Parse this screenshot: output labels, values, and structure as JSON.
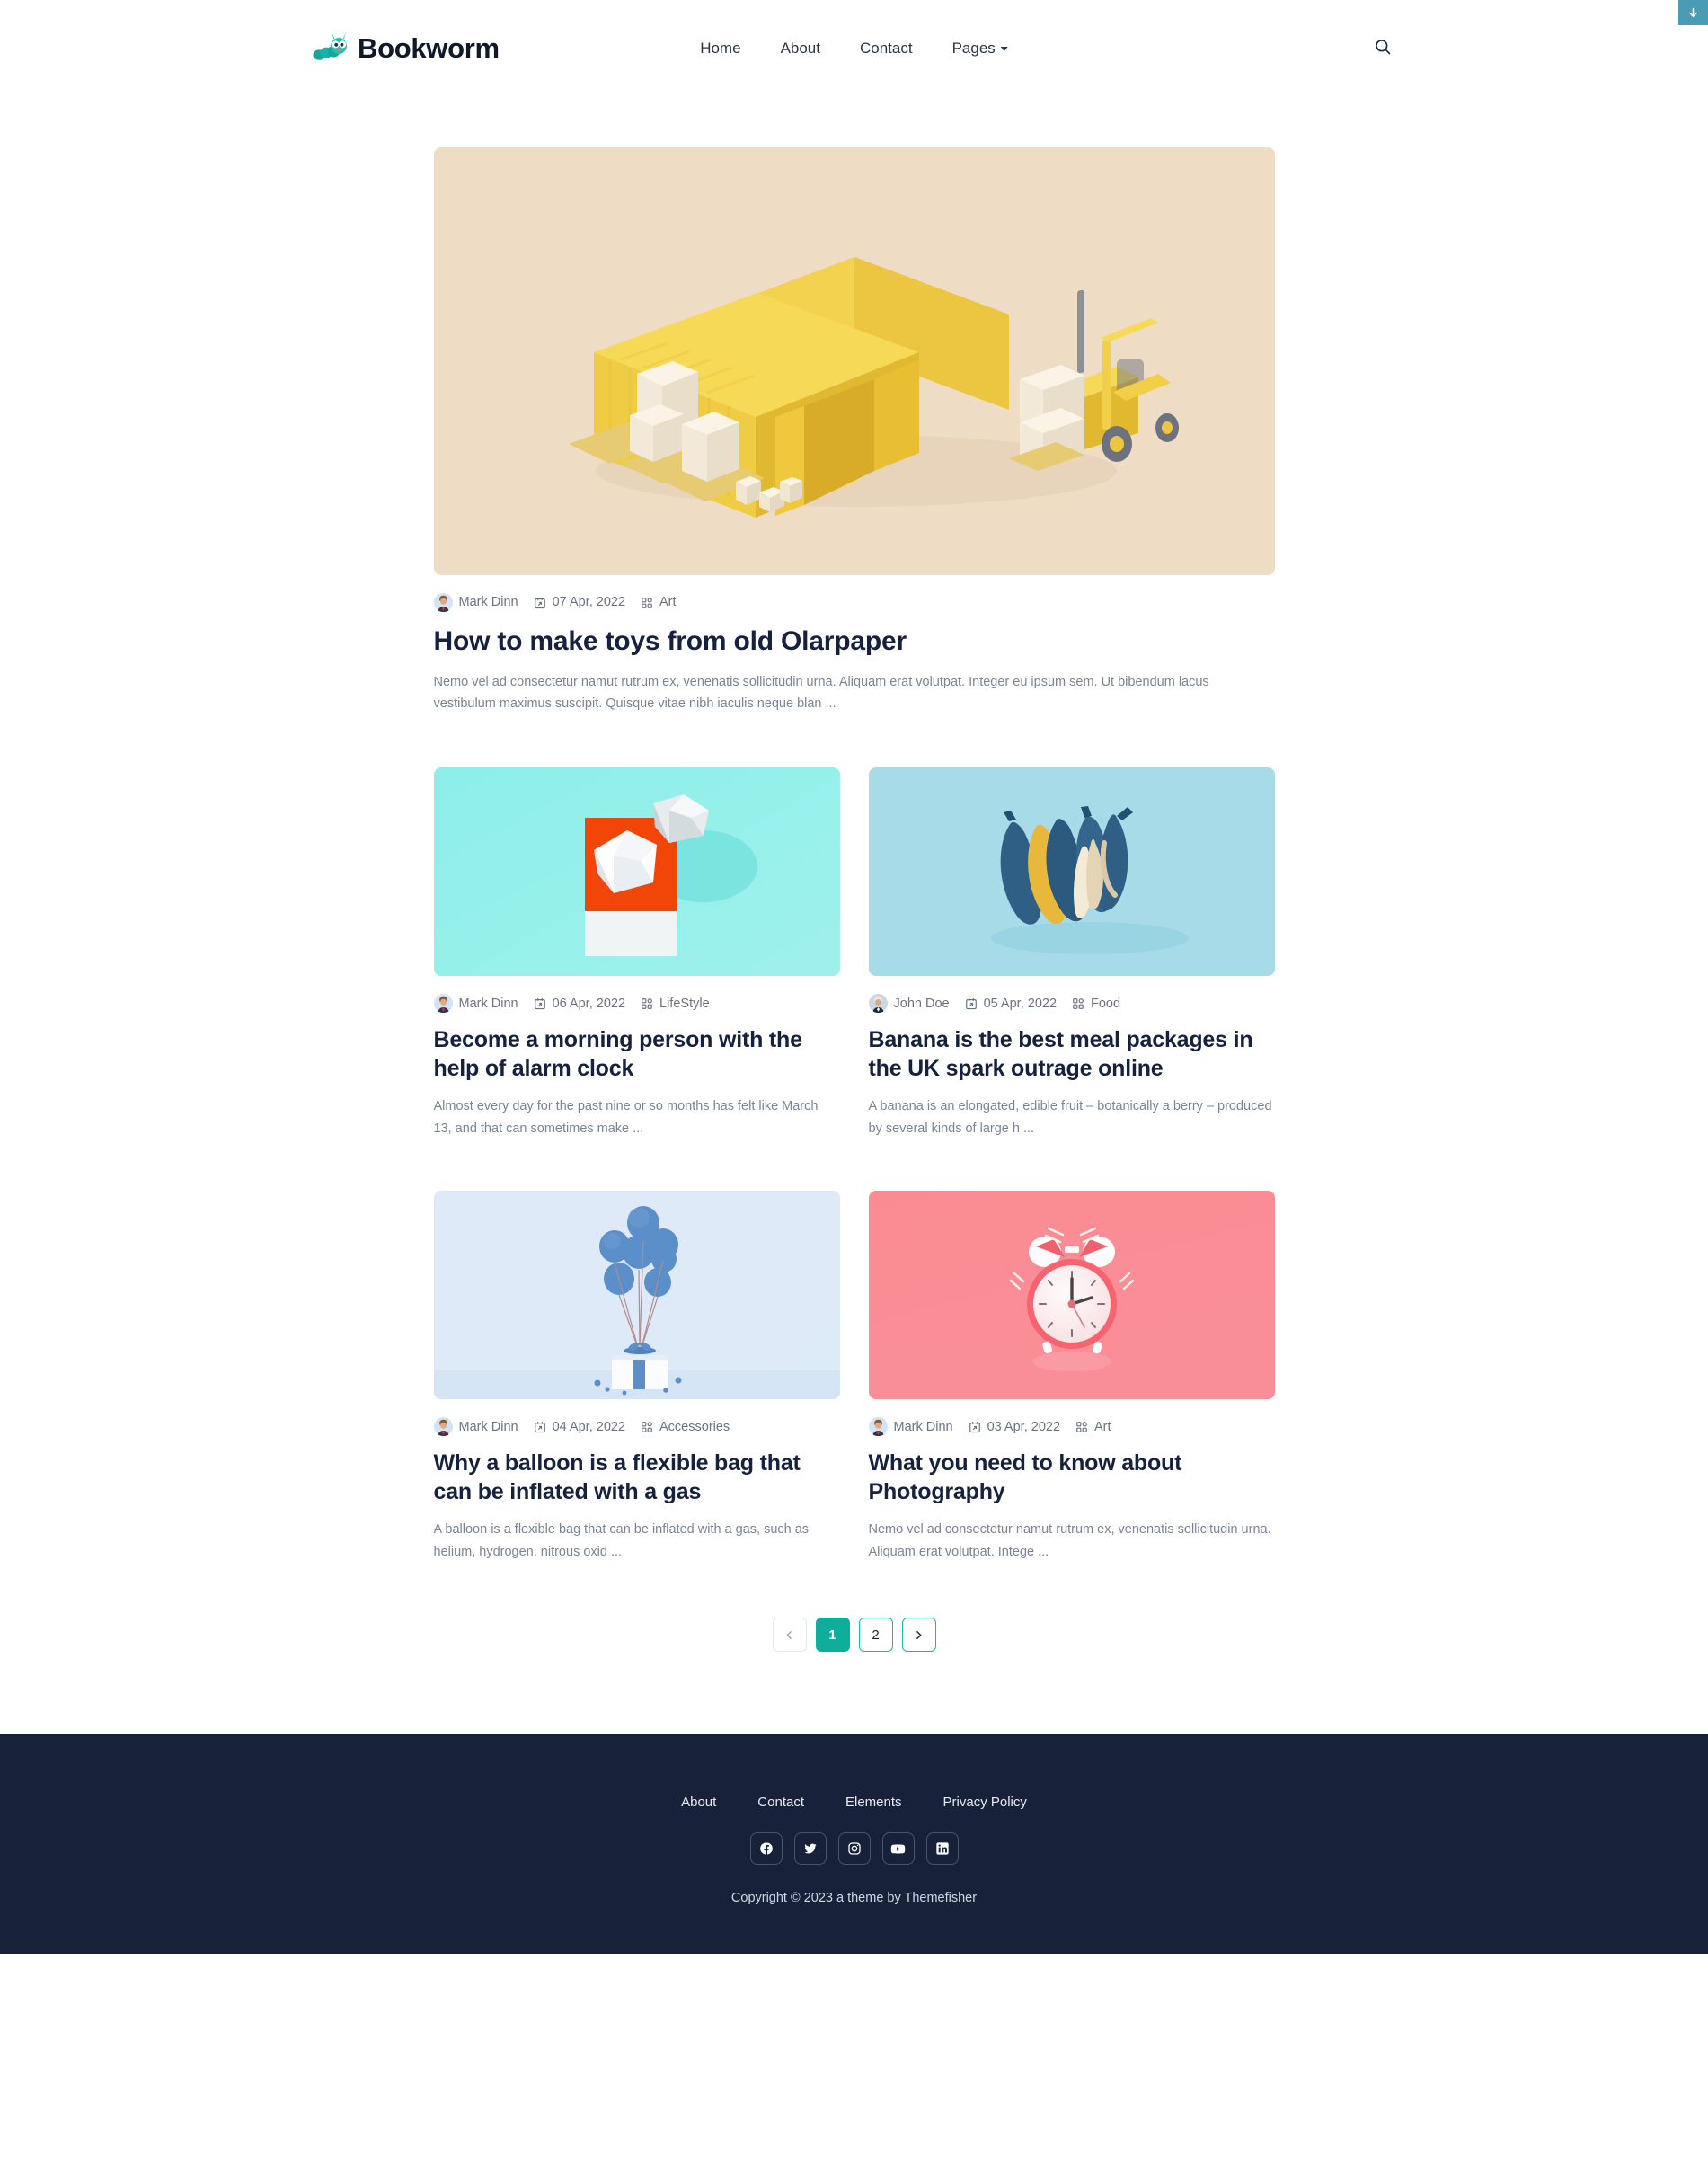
{
  "browser": {
    "download_chip_icon": "download-arrow-icon"
  },
  "header": {
    "brand_name": "Bookworm",
    "brand_icon": "bookworm-caterpillar-logo",
    "search_icon": "search-icon",
    "nav": [
      {
        "label": "Home",
        "has_caret": false
      },
      {
        "label": "About",
        "has_caret": false
      },
      {
        "label": "Contact",
        "has_caret": false
      },
      {
        "label": "Pages",
        "has_caret": true
      }
    ]
  },
  "main": {
    "featured_post": {
      "image_name": "yellow-shipping-container-forklift-3d-render",
      "author": "Mark Dinn",
      "author_avatar": "avatar-mark-dinn",
      "date": "07 Apr, 2022",
      "date_icon": "calendar-icon",
      "category": "Art",
      "category_icon": "grid-category-icon",
      "title": "How to make toys from old Olarpaper",
      "excerpt": "Nemo vel ad consectetur namut rutrum ex, venenatis sollicitudin urna. Aliquam erat volutpat. Integer eu ipsum sem. Ut bibendum lacus vestibulum maximus suscipit. Quisque vitae nibh iaculis neque blan ..."
    },
    "posts": [
      {
        "image_name": "paper-craft-geometric-shapes-on-cyan",
        "author": "Mark Dinn",
        "author_avatar": "avatar-mark-dinn",
        "date": "06 Apr, 2022",
        "date_icon": "calendar-icon",
        "category": "LifeStyle",
        "category_icon": "grid-category-icon",
        "title": "Become a morning person with the help of alarm clock",
        "excerpt": "Almost every day for the past nine or so months has felt like March 13, and that can sometimes make ..."
      },
      {
        "image_name": "blue-painted-bananas-on-light-blue",
        "author": "John Doe",
        "author_avatar": "avatar-john-doe",
        "date": "05 Apr, 2022",
        "date_icon": "calendar-icon",
        "category": "Food",
        "category_icon": "grid-category-icon",
        "title": "Banana is the best meal packages in the UK spark outrage online",
        "excerpt": "A banana is an elongated, edible fruit – botanically a berry – produced by several kinds of large h ..."
      },
      {
        "image_name": "blue-balloons-with-white-gift-box",
        "author": "Mark Dinn",
        "author_avatar": "avatar-mark-dinn",
        "date": "04 Apr, 2022",
        "date_icon": "calendar-icon",
        "category": "Accessories",
        "category_icon": "grid-category-icon",
        "title": "Why a balloon is a flexible bag that can be inflated with a gas",
        "excerpt": "A balloon is a flexible bag that can be inflated with a gas, such as helium, hydrogen, nitrous oxid ..."
      },
      {
        "image_name": "pink-alarm-clock-on-pink-background",
        "author": "Mark Dinn",
        "author_avatar": "avatar-mark-dinn",
        "date": "03 Apr, 2022",
        "date_icon": "calendar-icon",
        "category": "Art",
        "category_icon": "grid-category-icon",
        "title": "What you need to know about Photography",
        "excerpt": "Nemo vel ad consectetur namut rutrum ex, venenatis sollicitudin urna. Aliquam erat volutpat. Intege ..."
      }
    ],
    "pagination": {
      "prev_icon": "chevron-left-icon",
      "next_icon": "chevron-right-icon",
      "pages": [
        {
          "label": "1",
          "active": true
        },
        {
          "label": "2",
          "active": false
        }
      ]
    }
  },
  "footer": {
    "nav": [
      {
        "label": "About"
      },
      {
        "label": "Contact"
      },
      {
        "label": "Elements"
      },
      {
        "label": "Privacy Policy"
      }
    ],
    "social": [
      {
        "name": "facebook-icon"
      },
      {
        "name": "twitter-icon"
      },
      {
        "name": "instagram-icon"
      },
      {
        "name": "youtube-icon"
      },
      {
        "name": "linkedin-icon"
      }
    ],
    "copyright": "Copyright © 2023 a theme by Themefisher"
  },
  "colors": {
    "accent_teal": "#0fae9b",
    "heading": "#16213e",
    "body_text": "#7b8494",
    "footer_bg": "#17213a",
    "download_chip": "#4a9cb5"
  }
}
